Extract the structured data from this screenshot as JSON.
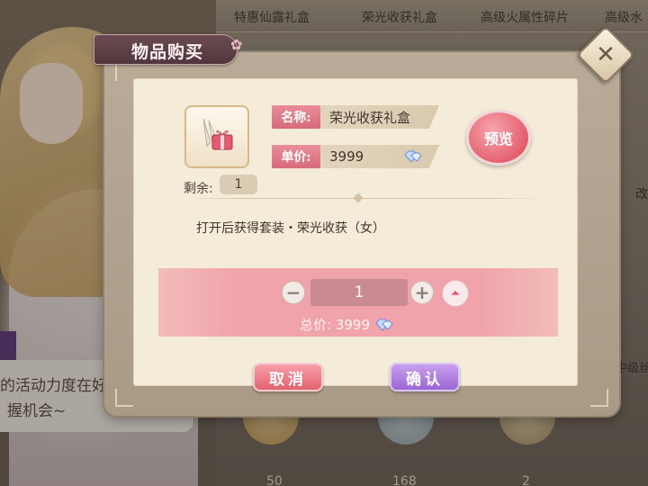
{
  "background": {
    "tabs": [
      "特惠仙露礼盒",
      "荣光收获礼盒",
      "高级火属性碎片",
      "高级水"
    ],
    "speech_lines": [
      "的活动力度在好!",
      "握机会~"
    ],
    "item_counts": [
      "50",
      "168",
      "2"
    ],
    "right_labels": [
      "改",
      "中级丝"
    ]
  },
  "dialog": {
    "title": "物品购买",
    "item": {
      "name_label": "名称:",
      "name": "荣光收获礼盒",
      "price_label": "单价:",
      "price": "3999",
      "remaining_label": "剩余:",
      "remaining": "1"
    },
    "preview_label": "预览",
    "description": "打开后获得套装・荣光收获（女）",
    "quantity": {
      "value": "1",
      "minus_symbol": "−",
      "plus_symbol": "+",
      "max_symbol": "⏶",
      "total_label": "总价:",
      "total_value": "3999"
    },
    "cancel_label": "取消",
    "confirm_label": "确认"
  },
  "colors": {
    "accent_pink": "#e4606f",
    "accent_purple": "#9c66d4",
    "panel_bg": "#f4ecd8"
  },
  "icons": [
    "close-icon",
    "gift-box-icon",
    "diamond-icon",
    "arrow-up-icon"
  ]
}
